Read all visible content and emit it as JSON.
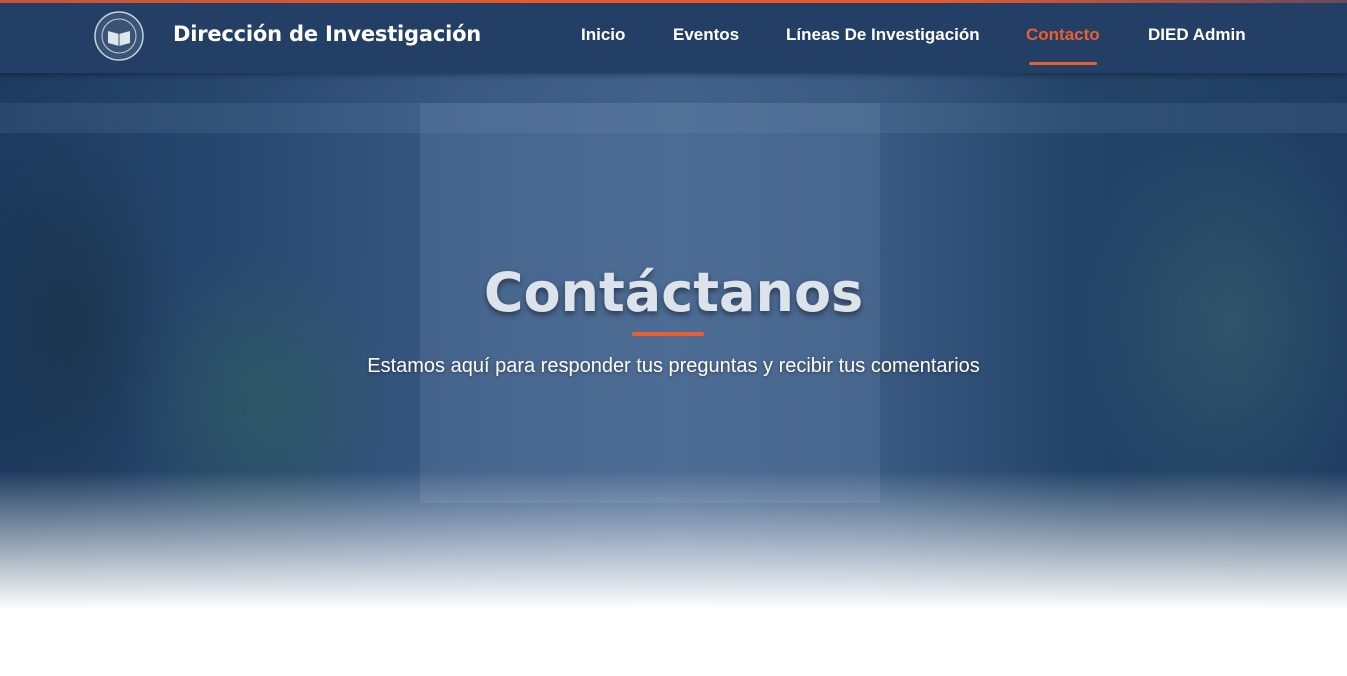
{
  "header": {
    "brand": "Dirección de Investigación",
    "nav": [
      {
        "label": "Inicio"
      },
      {
        "label": "Eventos"
      },
      {
        "label": "Líneas De Investigación"
      },
      {
        "label": "Contacto",
        "active": true
      },
      {
        "label": "DIED Admin"
      }
    ]
  },
  "hero": {
    "title": "Contáctanos",
    "subtitle": "Estamos aquí para responder tus preguntas y recibir tus comentarios"
  },
  "colors": {
    "accent": "#e8602f",
    "navbar": "#243f66"
  }
}
